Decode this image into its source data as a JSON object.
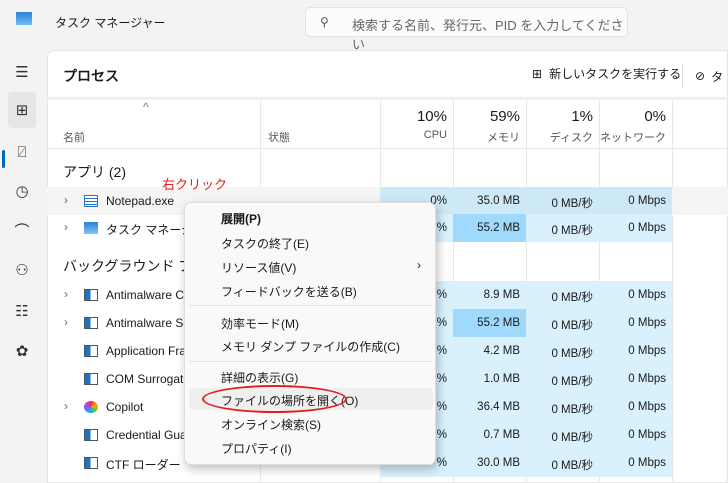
{
  "app": {
    "title": "タスク マネージャー",
    "search_placeholder": "検索する名前、発行元、PID を入力してください"
  },
  "sidebar": [
    "menu-icon",
    "processes-icon",
    "performance-icon",
    "app-history-icon",
    "startup-icon",
    "users-icon",
    "details-icon",
    "services-icon"
  ],
  "page": {
    "title": "プロセス",
    "new_task": "新しいタスクを実行する",
    "end_task": "タ"
  },
  "columns": {
    "name": "名前",
    "status": "状態",
    "cpu_pct": "10%",
    "cpu": "CPU",
    "mem_pct": "59%",
    "mem": "メモリ",
    "disk_pct": "1%",
    "disk": "ディスク",
    "net_pct": "0%",
    "net": "ネットワーク"
  },
  "groups": {
    "apps": "アプリ (2)",
    "background": "バックグラウンド プロ"
  },
  "rows": [
    {
      "name": "Notepad.exe",
      "cpu": "0%",
      "mem": "35.0 MB",
      "disk": "0 MB/秒",
      "net": "0 Mbps"
    },
    {
      "name": "タスク マネージャー",
      "cpu": "%",
      "mem": "55.2 MB",
      "disk": "0 MB/秒",
      "net": "0 Mbps"
    },
    {
      "name": "Antimalware C",
      "cpu": "%",
      "mem": "8.9 MB",
      "disk": "0 MB/秒",
      "net": "0 Mbps"
    },
    {
      "name": "Antimalware Se",
      "cpu": "%",
      "mem": "55.2 MB",
      "disk": "0 MB/秒",
      "net": "0 Mbps"
    },
    {
      "name": "Application Fra",
      "cpu": "%",
      "mem": "4.2 MB",
      "disk": "0 MB/秒",
      "net": "0 Mbps"
    },
    {
      "name": "COM Surrogate",
      "cpu": "%",
      "mem": "1.0 MB",
      "disk": "0 MB/秒",
      "net": "0 Mbps"
    },
    {
      "name": "Copilot",
      "cpu": "%",
      "mem": "36.4 MB",
      "disk": "0 MB/秒",
      "net": "0 Mbps"
    },
    {
      "name": "Credential Gua",
      "cpu": "%",
      "mem": "0.7 MB",
      "disk": "0 MB/秒",
      "net": "0 Mbps"
    },
    {
      "name": "CTF ローダー",
      "cpu": "%",
      "mem": "30.0 MB",
      "disk": "0 MB/秒",
      "net": "0 Mbps"
    }
  ],
  "annotation": "右クリック",
  "context_menu": [
    "展開(P)",
    "タスクの終了(E)",
    "リソース値(V)",
    "フィードバックを送る(B)",
    "効率モード(M)",
    "メモリ ダンプ ファイルの作成(C)",
    "詳細の表示(G)",
    "ファイルの場所を開く(O)",
    "オンライン検索(S)",
    "プロパティ(I)"
  ],
  "colors": {
    "accent": "#0067c0",
    "annotation": "#e0201c",
    "cell": "#d9f0fd",
    "cell_high": "#9fd9fb"
  }
}
